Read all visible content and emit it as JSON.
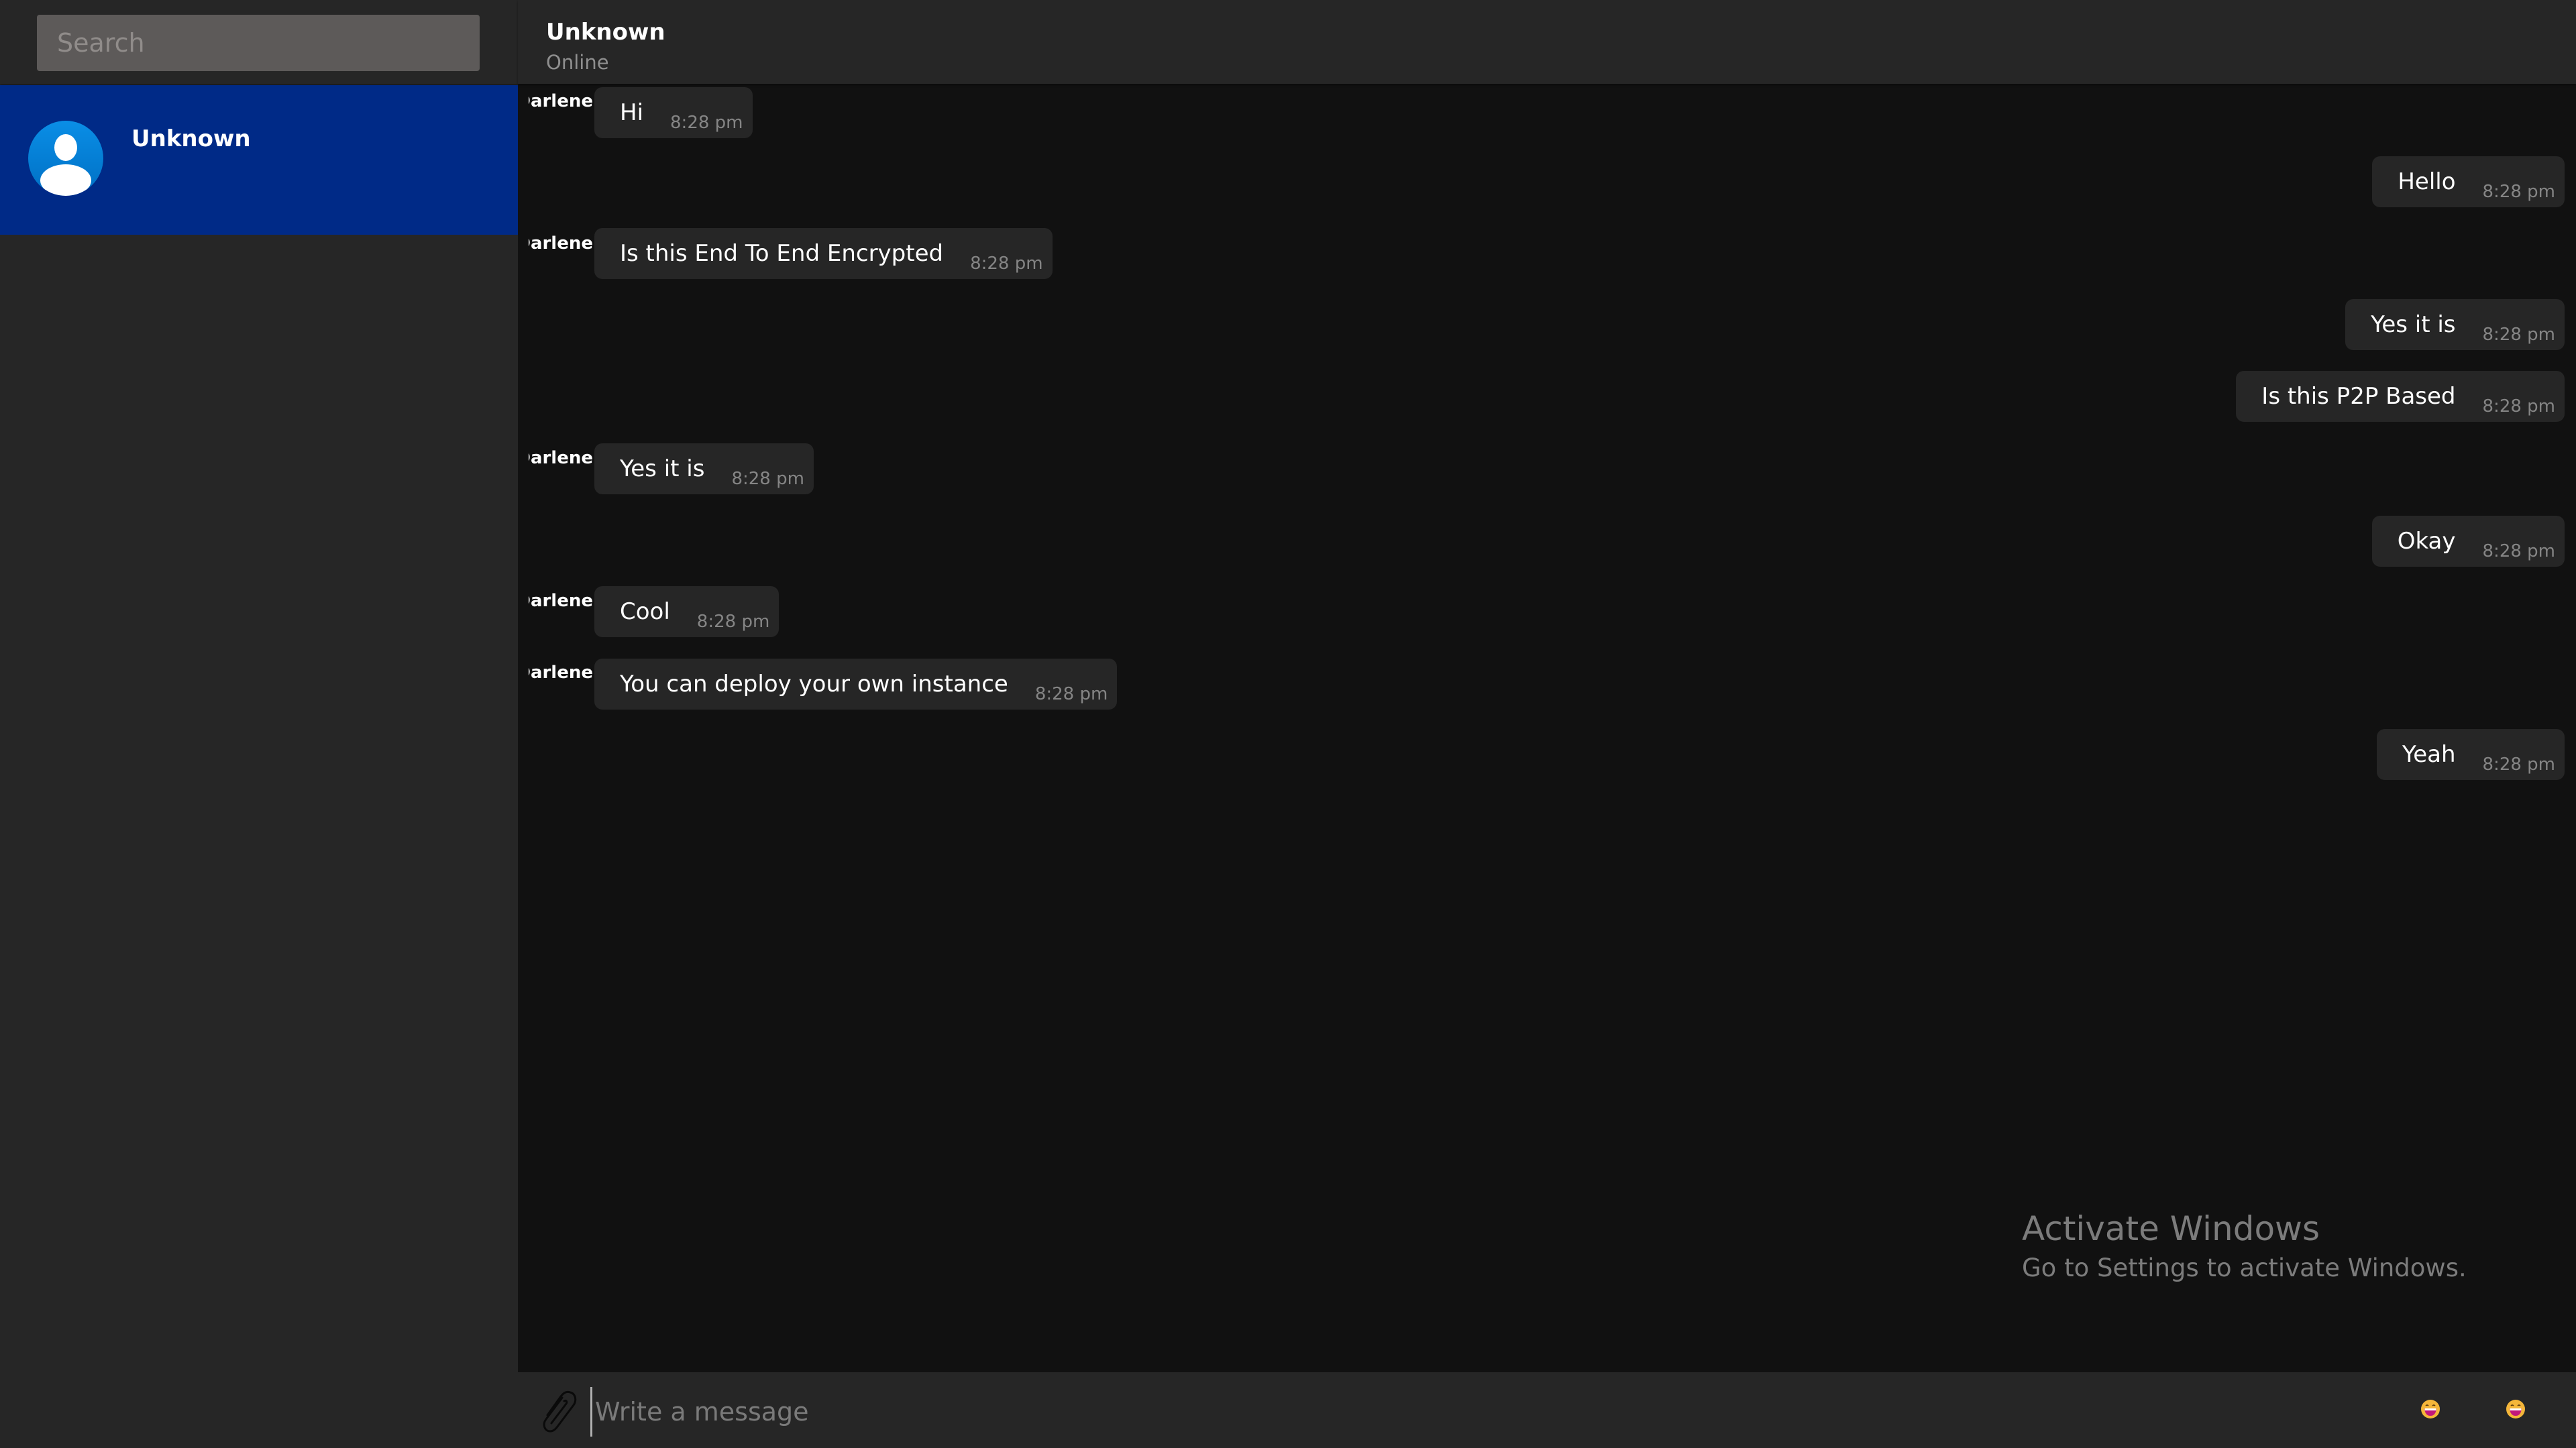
{
  "sidebar": {
    "search_placeholder": "Search",
    "search_value": "",
    "contacts": [
      {
        "name": "Unknown",
        "selected": true,
        "avatar_icon": "user-avatar-icon"
      }
    ]
  },
  "header": {
    "title": "Unknown",
    "status": "Online"
  },
  "messages": [
    {
      "side": "left",
      "sender": "Darlene",
      "text": "Hi",
      "time": "8:28 pm"
    },
    {
      "side": "right",
      "sender": "",
      "text": "Hello",
      "time": "8:28 pm"
    },
    {
      "side": "left",
      "sender": "Darlene",
      "text": "Is this End To End Encrypted",
      "time": "8:28 pm"
    },
    {
      "side": "right",
      "sender": "",
      "text": "Yes it is",
      "time": "8:28 pm"
    },
    {
      "side": "right",
      "sender": "",
      "text": "Is this P2P Based",
      "time": "8:28 pm"
    },
    {
      "side": "left",
      "sender": "Darlene",
      "text": "Yes it is",
      "time": "8:28 pm"
    },
    {
      "side": "right",
      "sender": "",
      "text": "Okay",
      "time": "8:28 pm"
    },
    {
      "side": "left",
      "sender": "Darlene",
      "text": "Cool",
      "time": "8:28 pm"
    },
    {
      "side": "left",
      "sender": "Darlene",
      "text": "You can deploy your own instance",
      "time": "8:28 pm"
    },
    {
      "side": "right",
      "sender": "",
      "text": "Yeah",
      "time": "8:28 pm"
    }
  ],
  "composer": {
    "placeholder": "Write a message",
    "value": "",
    "attach_icon": "paperclip-icon",
    "emoji_icons": [
      "laughing-emoji-icon",
      "laughing-emoji-icon"
    ]
  },
  "watermark": {
    "title": "Activate Windows",
    "subtitle": "Go to Settings to activate Windows."
  },
  "colors": {
    "selected_contact_bg": "#002a87",
    "panel_bg": "#262626",
    "chat_bg": "#111111",
    "bubble_bg": "#262626",
    "avatar_blue": "#0a86dc"
  }
}
